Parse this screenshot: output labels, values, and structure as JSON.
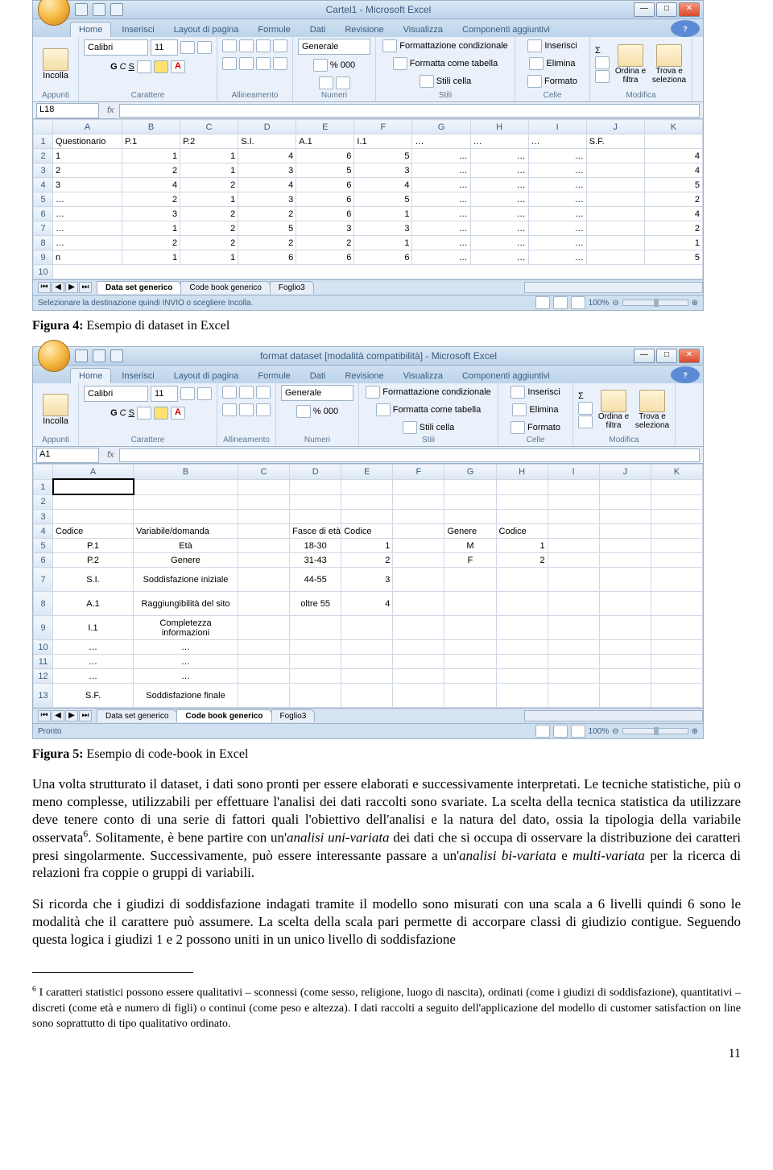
{
  "excel1": {
    "title": "Cartel1 - Microsoft Excel",
    "tabs": [
      "Home",
      "Inserisci",
      "Layout di pagina",
      "Formule",
      "Dati",
      "Revisione",
      "Visualizza",
      "Componenti aggiuntivi"
    ],
    "ribbon": {
      "paste": "Incolla",
      "font": "Calibri",
      "size": "11",
      "bold": "G",
      "italic": "C",
      "under": "S",
      "numfmt": "Generale",
      "condfmt": "Formattazione condizionale",
      "astable": "Formatta come tabella",
      "cellstyles": "Stili cella",
      "insert": "Inserisci",
      "delete": "Elimina",
      "format": "Formato",
      "sortfilter": "Ordina e filtra",
      "findsel": "Trova e seleziona",
      "groups": [
        "Appunti",
        "Carattere",
        "Allineamento",
        "Numeri",
        "Stili",
        "Celle",
        "Modifica"
      ]
    },
    "cellref": "L18",
    "cols": [
      "A",
      "B",
      "C",
      "D",
      "E",
      "F",
      "G",
      "H",
      "I",
      "J",
      "K"
    ],
    "rows": [
      [
        "Questionario",
        "P.1",
        "P.2",
        "S.I.",
        "A.1",
        "I.1",
        "…",
        "…",
        "…",
        "S.F.",
        ""
      ],
      [
        "1",
        "1",
        "1",
        "4",
        "6",
        "5",
        "…",
        "…",
        "…",
        "",
        "4"
      ],
      [
        "2",
        "2",
        "1",
        "3",
        "5",
        "3",
        "…",
        "…",
        "…",
        "",
        "4"
      ],
      [
        "3",
        "4",
        "2",
        "4",
        "6",
        "4",
        "…",
        "…",
        "…",
        "",
        "5"
      ],
      [
        "…",
        "2",
        "1",
        "3",
        "6",
        "5",
        "…",
        "…",
        "…",
        "",
        "2"
      ],
      [
        "…",
        "3",
        "2",
        "2",
        "6",
        "1",
        "…",
        "…",
        "…",
        "",
        "4"
      ],
      [
        "…",
        "1",
        "2",
        "5",
        "3",
        "3",
        "…",
        "…",
        "…",
        "",
        "2"
      ],
      [
        "…",
        "2",
        "2",
        "2",
        "2",
        "1",
        "…",
        "…",
        "…",
        "",
        "1"
      ],
      [
        "n",
        "1",
        "1",
        "6",
        "6",
        "6",
        "…",
        "…",
        "…",
        "",
        "5"
      ]
    ],
    "sheets": [
      "Data set generico",
      "Code book generico",
      "Foglio3"
    ],
    "activesheet": 0,
    "status": "Selezionare la destinazione quindi INVIO o scegliere Incolla.",
    "zoom": "100%"
  },
  "excel2": {
    "title": "format dataset  [modalità compatibilità] - Microsoft Excel",
    "cellref": "A1",
    "cols": [
      "A",
      "B",
      "C",
      "D",
      "E",
      "F",
      "G",
      "H",
      "I",
      "J",
      "K"
    ],
    "body": {
      "r4": [
        "Codice",
        "Variabile/domanda",
        "",
        "Fasce di età",
        "Codice",
        "",
        "Genere",
        "Codice",
        "",
        "",
        ""
      ],
      "r5": [
        "P.1",
        "Età",
        "",
        "18-30",
        "1",
        "",
        "M",
        "1",
        "",
        "",
        ""
      ],
      "r6": [
        "P.2",
        "Genere",
        "",
        "31-43",
        "2",
        "",
        "F",
        "2",
        "",
        "",
        ""
      ],
      "r7": [
        "S.I.",
        "Soddisfazione iniziale",
        "",
        "44-55",
        "3",
        "",
        "",
        "",
        "",
        "",
        ""
      ],
      "r8": [
        "A.1",
        "Raggiungibilità del sito",
        "",
        "oltre 55",
        "4",
        "",
        "",
        "",
        "",
        "",
        ""
      ],
      "r9": [
        "I.1",
        "Completezza informazioni",
        "",
        "",
        "",
        "",
        "",
        "",
        "",
        "",
        ""
      ],
      "r10": [
        "…",
        "…",
        "",
        "",
        "",
        "",
        "",
        "",
        "",
        "",
        ""
      ],
      "r11": [
        "…",
        "…",
        "",
        "",
        "",
        "",
        "",
        "",
        "",
        "",
        ""
      ],
      "r12": [
        "…",
        "…",
        "",
        "",
        "",
        "",
        "",
        "",
        "",
        "",
        ""
      ],
      "r13": [
        "S.F.",
        "Soddisfazione finale",
        "",
        "",
        "",
        "",
        "",
        "",
        "",
        "",
        ""
      ]
    },
    "sheets": [
      "Data set generico",
      "Code book generico",
      "Foglio3"
    ],
    "activesheet": 1,
    "status": "Pronto",
    "zoom": "100%"
  },
  "captions": {
    "fig4": "Figura 4:",
    "fig4t": " Esempio di dataset in Excel",
    "fig5": "Figura 5:",
    "fig5t": " Esempio di code-book in Excel"
  },
  "para": {
    "p1a": "Una volta strutturato il dataset, i dati sono pronti per essere elaborati e successivamente interpretati. Le tecniche statistiche, più o meno complesse, utilizzabili per effettuare l'analisi dei dati raccolti sono svariate. La scelta della tecnica statistica da utilizzare deve tenere conto di una serie di fattori quali l'obiettivo dell'analisi e la natura del dato, ossia la tipologia della variabile osservata",
    "p1b": ". Solitamente, è bene partire con un'",
    "p1c": "analisi uni-variata",
    "p1d": " dei dati che si occupa di osservare la distribuzione dei caratteri presi singolarmente. Successivamente, può essere interessante passare a un'",
    "p1e": "analisi bi-variata",
    "p1f": " e ",
    "p1g": "multi-variata",
    "p1h": " per la ricerca di relazioni fra coppie o gruppi di variabili.",
    "p2": "Si ricorda che i giudizi di soddisfazione indagati tramite il modello sono misurati con una scala a 6 livelli quindi 6 sono le modalità che il carattere può assumere. La scelta della scala pari permette di accorpare classi di giudizio contigue. Seguendo questa logica i giudizi 1 e 2 possono uniti in un unico livello di soddisfazione"
  },
  "footnote": {
    "num": "6",
    "text": " I caratteri statistici possono essere qualitativi – sconnessi (come sesso, religione, luogo di nascita), ordinati (come i giudizi di soddisfazione), quantitativi – discreti (come età e numero di figli) o continui (come peso e altezza). I dati raccolti a seguito dell'applicazione del modello di customer satisfaction on line sono soprattutto di tipo qualitativo ordinato."
  },
  "pagenum": "11",
  "sym": {
    "pct": "%",
    "thou": "000",
    "sigma": "Σ",
    "dash": "—"
  }
}
